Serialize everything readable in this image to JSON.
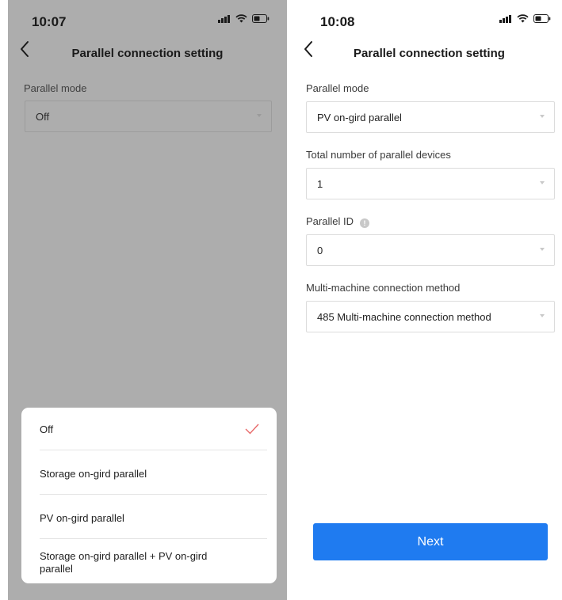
{
  "left": {
    "status": {
      "time": "10:07"
    },
    "nav": {
      "title": "Parallel connection setting"
    },
    "parallel_mode": {
      "label": "Parallel mode",
      "value": "Off"
    },
    "sheet": {
      "options": [
        {
          "label": "Off",
          "selected": true
        },
        {
          "label": "Storage on-gird parallel",
          "selected": false
        },
        {
          "label": "PV on-gird parallel",
          "selected": false
        },
        {
          "label": "Storage on-gird parallel + PV on-gird parallel",
          "selected": false
        }
      ]
    }
  },
  "right": {
    "status": {
      "time": "10:08"
    },
    "nav": {
      "title": "Parallel connection setting"
    },
    "fields": [
      {
        "label": "Parallel mode",
        "value": "PV on-gird parallel"
      },
      {
        "label": "Total number of parallel devices",
        "value": "1"
      },
      {
        "label": "Parallel ID",
        "value": "0"
      },
      {
        "label": "Multi-machine connection method",
        "value": "485 Multi-machine connection method"
      }
    ],
    "next_label": "Next"
  },
  "colors": {
    "overlay": "#adadad",
    "accent": "#1f7bf0",
    "check": "#e86a6a"
  },
  "icons": [
    "back-chevron-icon",
    "cellular-signal-icon",
    "wifi-icon",
    "battery-icon",
    "checkmark-icon",
    "info-icon",
    "dropdown-caret-icon"
  ]
}
